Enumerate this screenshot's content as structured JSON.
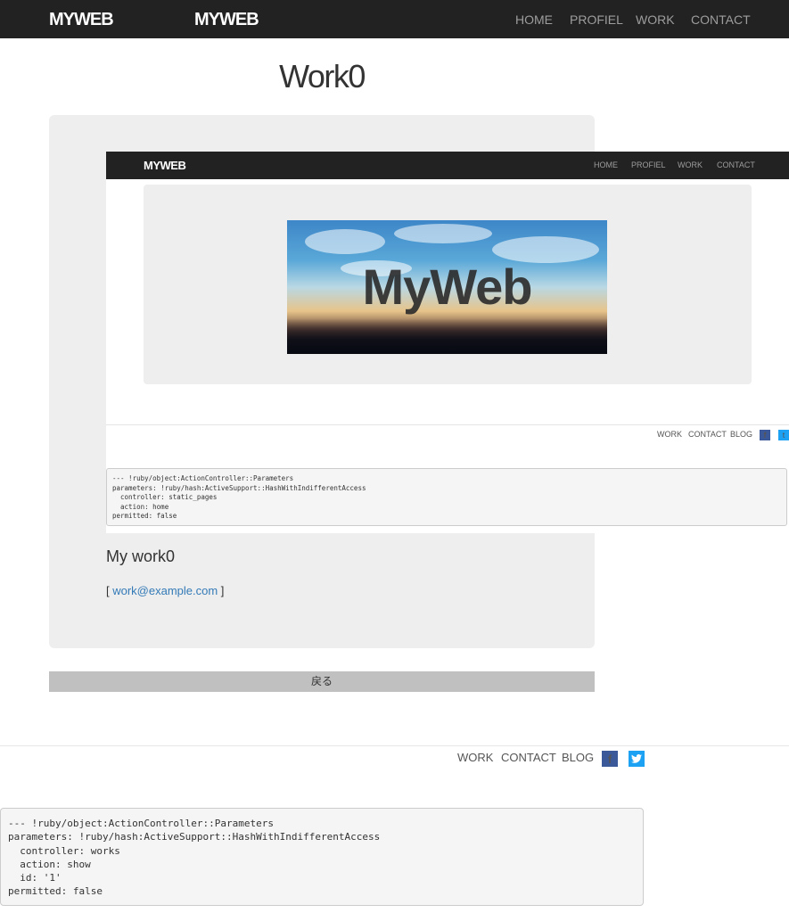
{
  "header": {
    "logo": "MYWEB",
    "logo_secondary": "MYWEB",
    "nav": [
      "HOME",
      "PROFIEL",
      "WORK",
      "CONTACT"
    ]
  },
  "page_title": "Work0",
  "embedded": {
    "logo": "MYWEB",
    "nav": [
      "HOME",
      "PROFIEL",
      "WORK",
      "CONTACT"
    ],
    "hero_text": "MyWeb",
    "footer_links": [
      "WORK",
      "CONTACT",
      "BLOG"
    ],
    "debug": "--- !ruby/object:ActionController::Parameters\nparameters: !ruby/hash:ActiveSupport::HashWithIndifferentAccess\n  controller: static_pages\n  action: home\npermitted: false"
  },
  "work": {
    "title": "My work0",
    "email_prefix": "[ ",
    "email": "work@example.com",
    "email_suffix": " ]"
  },
  "back_button": "戻る",
  "footer": {
    "links": [
      "WORK",
      "CONTACT",
      "BLOG"
    ],
    "facebook_icon": "facebook-icon",
    "twitter_icon": "twitter-icon"
  },
  "debug": "--- !ruby/object:ActionController::Parameters\nparameters: !ruby/hash:ActiveSupport::HashWithIndifferentAccess\n  controller: works\n  action: show\n  id: '1'\npermitted: false",
  "colors": {
    "navbar": "#222222",
    "link": "#337ab7",
    "facebook": "#3b5998",
    "twitter": "#1da1f2"
  }
}
